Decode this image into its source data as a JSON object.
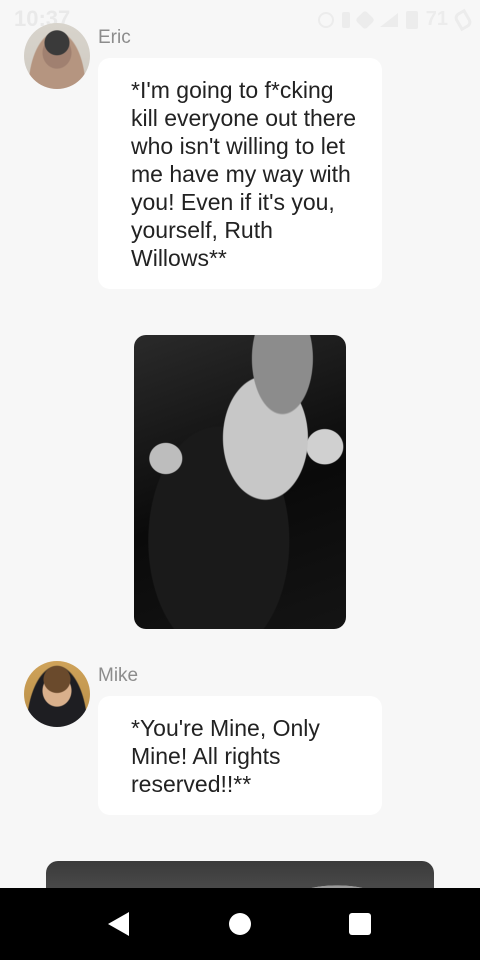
{
  "status_bar": {
    "time": "10:37",
    "battery_percent": "71"
  },
  "messages": [
    {
      "sender": "Eric",
      "text": "*I'm going to f*cking kill everyone out there who isn't willing to let me have my way with you! Even if it's you, yourself, Ruth Willows**"
    },
    {
      "sender": "Mike",
      "text": "*You're Mine, Only Mine! All rights reserved!!**"
    }
  ],
  "colors": {
    "background": "#f7f7f7",
    "bubble": "#ffffff",
    "sender_name": "#8c8c8c",
    "text": "#222222",
    "nav_bar": "#000000"
  },
  "icons": {
    "nav_back": "back-triangle-icon",
    "nav_home": "home-circle-icon",
    "nav_recents": "recents-square-icon"
  }
}
